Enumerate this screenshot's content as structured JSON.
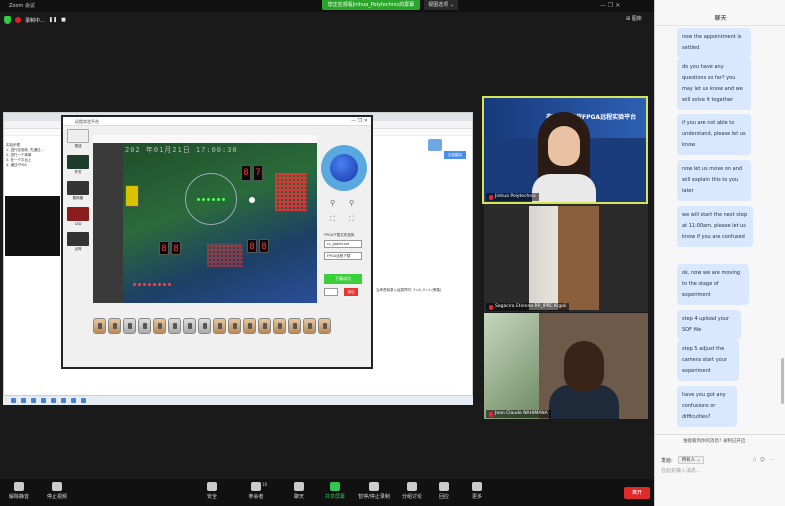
{
  "app": {
    "title": "Zoom 会议",
    "share_banner": "您正在观看Jinhua_Polytechnic的屏幕",
    "view_options": "视图选项 ⌄",
    "window_controls": "—  ❐  ✕",
    "gallery_view": "⊞ 图库",
    "recording_label": "录制中..."
  },
  "shared_screen": {
    "platform_title": "远程实验平台",
    "board_timestamp": "202 年01月21日  17:00:30",
    "panel_select_label": "FPGA下载文件选择",
    "panel_file": "cc_gated.sof",
    "panel_button": "FPGA远程下载",
    "panel_button_2": "下载成功",
    "panel_clear": "清空",
    "page_notes": [
      "实验步骤",
      "1. 进行实验前, 先通过...",
      "2. 进行一个简单",
      "3. 在一个平台上",
      "4. 通过FPGA"
    ],
    "right_text": "当考虑到录入运算符时, Y=A, Y=1 (旁路)",
    "tab_btn": "实验模拟",
    "tools": [
      "按钮",
      "开关",
      "数码管",
      "LED",
      "点阵"
    ]
  },
  "participants": [
    {
      "name": "Jinhua Polytechnic",
      "muted": true
    },
    {
      "name": "Sagacira Etienne RP_IPRC Kigali",
      "muted": true
    },
    {
      "name": "Jean Claude NAHIMANA",
      "muted": true
    }
  ],
  "tile_banner": "非洲职业院校FPGA远程实验平台",
  "chat": {
    "header": "聊天",
    "messages": [
      "now the appointment is settled",
      "do you have any questions so far? you may let us know and we will solve it together",
      "if you are not able to understand, please let us know",
      "now let us move on and will explain this to you later",
      "we will start the next step at 11:00am. please let us know if you are confused",
      "ok, now we are moving to the stage of experiment",
      "step 4 upload your SOF file",
      "step 5 adjust the camera start your experiment",
      "have you got any confusions or difficulties?"
    ],
    "note": "谁能看到你的消息? 录制已开启",
    "send_to_label": "发给:",
    "recipient": "所有人 ⌄",
    "input_placeholder": "在此处输入消息..."
  },
  "toolbar": {
    "items": [
      "解除静音",
      "停止视频",
      "安全",
      "参会者",
      "聊天",
      "共享屏幕",
      "暂停/停止录制",
      "分组讨论",
      "回应",
      "更多"
    ],
    "participant_count": "10",
    "leave": "离开"
  }
}
